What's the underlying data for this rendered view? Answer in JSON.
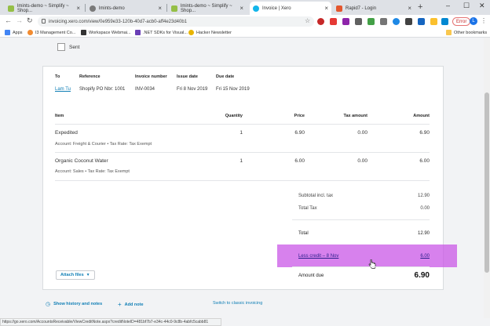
{
  "browser": {
    "tabs": [
      {
        "label": "lmints-demo ~ Simplify ~ Shop...",
        "icon_color": "#95bf47"
      },
      {
        "label": "lmints-demo",
        "icon_color": "#7a7a7a"
      },
      {
        "label": "lmints-demo ~ Simplify ~ Shop...",
        "icon_color": "#95bf47"
      },
      {
        "label": "Invoice | Xero",
        "icon_color": "#13b5ea"
      },
      {
        "label": "Rapid7 - Login",
        "icon_color": "#e4572e"
      }
    ],
    "new_tab": "+",
    "url": "invoicing.xero.com/view/0e959e33-120b-40d7-acb0-aff4e23d40b1",
    "error_label": "Error",
    "profile_initial": "L",
    "bookmarks": [
      {
        "label": "Apps",
        "icon_color": "#4285f4"
      },
      {
        "label": "I3 Management Co...",
        "icon_color": "#f28b30"
      },
      {
        "label": "Workspace Webmai...",
        "icon_color": "#333333"
      },
      {
        "label": ".NET SDKs for Visual...",
        "icon_color": "#6a3fb6"
      },
      {
        "label": "Hacker Newsletter",
        "icon_color": "#e8b400"
      }
    ],
    "other_bookmarks": "Other bookmarks"
  },
  "page": {
    "sent_label": "Sent",
    "header": {
      "to_label": "To",
      "to_value": "Lam Tu",
      "reference_label": "Reference",
      "reference_value": "Shopify PO Nbr: 1001",
      "invoice_number_label": "Invoice number",
      "invoice_number_value": "INV-0034",
      "issue_date_label": "Issue date",
      "issue_date_value": "Fri 8 Nov 2019",
      "due_date_label": "Due date",
      "due_date_value": "Fri 15 Nov 2019"
    },
    "columns": {
      "item": "Item",
      "quantity": "Quantity",
      "price": "Price",
      "tax_amount": "Tax amount",
      "amount": "Amount"
    },
    "line_items": [
      {
        "item": "Expedited",
        "quantity": "1",
        "price": "6.90",
        "tax_amount": "0.00",
        "amount": "6.90",
        "detail": "Account: Freight & Courier • Tax Rate: Tax Exempt"
      },
      {
        "item": "Organic Coconut Water",
        "quantity": "1",
        "price": "6.00",
        "tax_amount": "0.00",
        "amount": "6.00",
        "detail": "Account: Sales • Tax Rate: Tax Exempt"
      }
    ],
    "totals": {
      "subtotal_label": "Subtotal incl. tax",
      "subtotal_value": "12.90",
      "total_tax_label": "Total Tax",
      "total_tax_value": "0.00",
      "total_label": "Total",
      "total_value": "12.90",
      "less_credit_label": "Less credit – 8 Nov",
      "less_credit_value": "6.00",
      "amount_due_label": "Amount due",
      "amount_due_value": "6.90"
    },
    "attach_files_label": "Attach files",
    "show_history_label": "Show history and notes",
    "add_note_label": "Add note",
    "switch_classic_label": "Switch to classic invoicing",
    "highlight_color": "#c751e6"
  },
  "status_url": "https://go.xero.com/AccountsReceivable/ViewCreditNote.aspx?creditNoteID=481bf7b7-e34c-44c0-9c8b-4abfc5cabb81"
}
